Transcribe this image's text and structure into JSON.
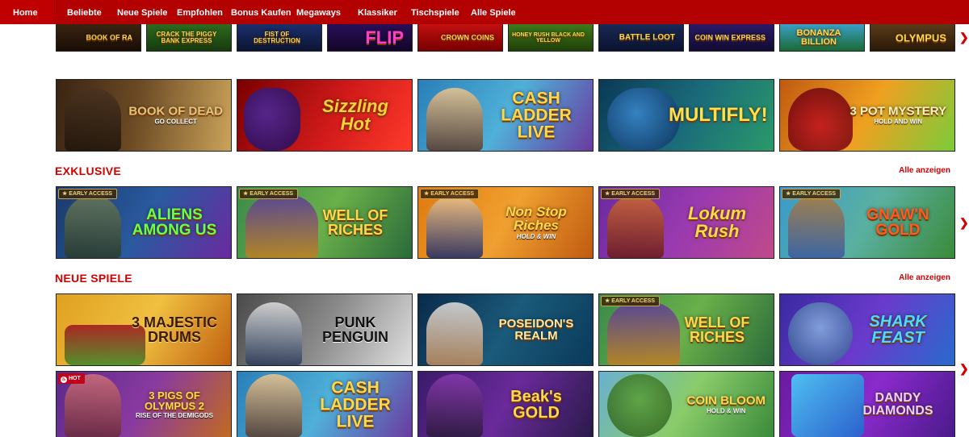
{
  "nav": {
    "items": [
      "Home",
      "Beliebte",
      "Neue Spiele",
      "Empfohlen",
      "Bonus Kaufen",
      "Megaways",
      "Klassiker",
      "Tischspiele",
      "Alle Spiele"
    ]
  },
  "row_top": [
    "BOOK OF RA",
    "CRACK THE PIGGY BANK EXPRESS",
    "FIST OF DESTRUCTION",
    "FLIP",
    "CROWN COINS",
    "HONEY RUSH BLACK AND YELLOW",
    "BATTLE LOOT",
    "COIN WIN EXPRESS",
    "BONANZA BILLION",
    "OLYMPUS"
  ],
  "row_featured": [
    {
      "title": "BOOK OF DEAD",
      "sub": "GO COLLECT"
    },
    {
      "title": "Sizzling Hot",
      "sub": ""
    },
    {
      "title": "CASH LADDER LIVE",
      "sub": ""
    },
    {
      "title": "MULTIFLY!",
      "sub": ""
    },
    {
      "title": "3 POT MYSTERY",
      "sub": "HOLD AND WIN"
    }
  ],
  "exklusive": {
    "title": "EXKLUSIVE",
    "link": "Alle anzeigen",
    "badge": "EARLY ACCESS",
    "tiles": [
      {
        "title": "ALIENS AMONG US",
        "sub": ""
      },
      {
        "title": "WELL OF RICHES",
        "sub": ""
      },
      {
        "title": "Non Stop Riches",
        "sub": "HOLD & WIN"
      },
      {
        "title": "Lokum Rush",
        "sub": ""
      },
      {
        "title": "GNAW'N GOLD",
        "sub": ""
      }
    ]
  },
  "neue_spiele": {
    "title": "NEUE SPIELE",
    "link": "Alle anzeigen",
    "badge": "EARLY ACCESS",
    "hot": "HOT",
    "row1": [
      {
        "title": "3 MAJESTIC DRUMS",
        "sub": ""
      },
      {
        "title": "PUNK PENGUIN",
        "sub": ""
      },
      {
        "title": "POSEIDON'S REALM",
        "sub": ""
      },
      {
        "title": "WELL OF RICHES",
        "sub": ""
      },
      {
        "title": "SHARK FEAST",
        "sub": ""
      }
    ],
    "row2": [
      {
        "title": "3 PIGS OF OLYMPUS 2",
        "sub": "RISE OF THE DEMIGODS"
      },
      {
        "title": "CASH LADDER LIVE",
        "sub": ""
      },
      {
        "title": "Beak's GOLD",
        "sub": ""
      },
      {
        "title": "COIN BLOOM",
        "sub": "HOLD & WIN"
      },
      {
        "title": "DANDY DIAMONDS",
        "sub": ""
      }
    ]
  },
  "icons": {
    "next_arrow": "chevron-right-icon",
    "badge": "star-icon",
    "hot": "flame-icon"
  },
  "colors": {
    "brand_red": "#b30000",
    "accent_red": "#d40000"
  }
}
